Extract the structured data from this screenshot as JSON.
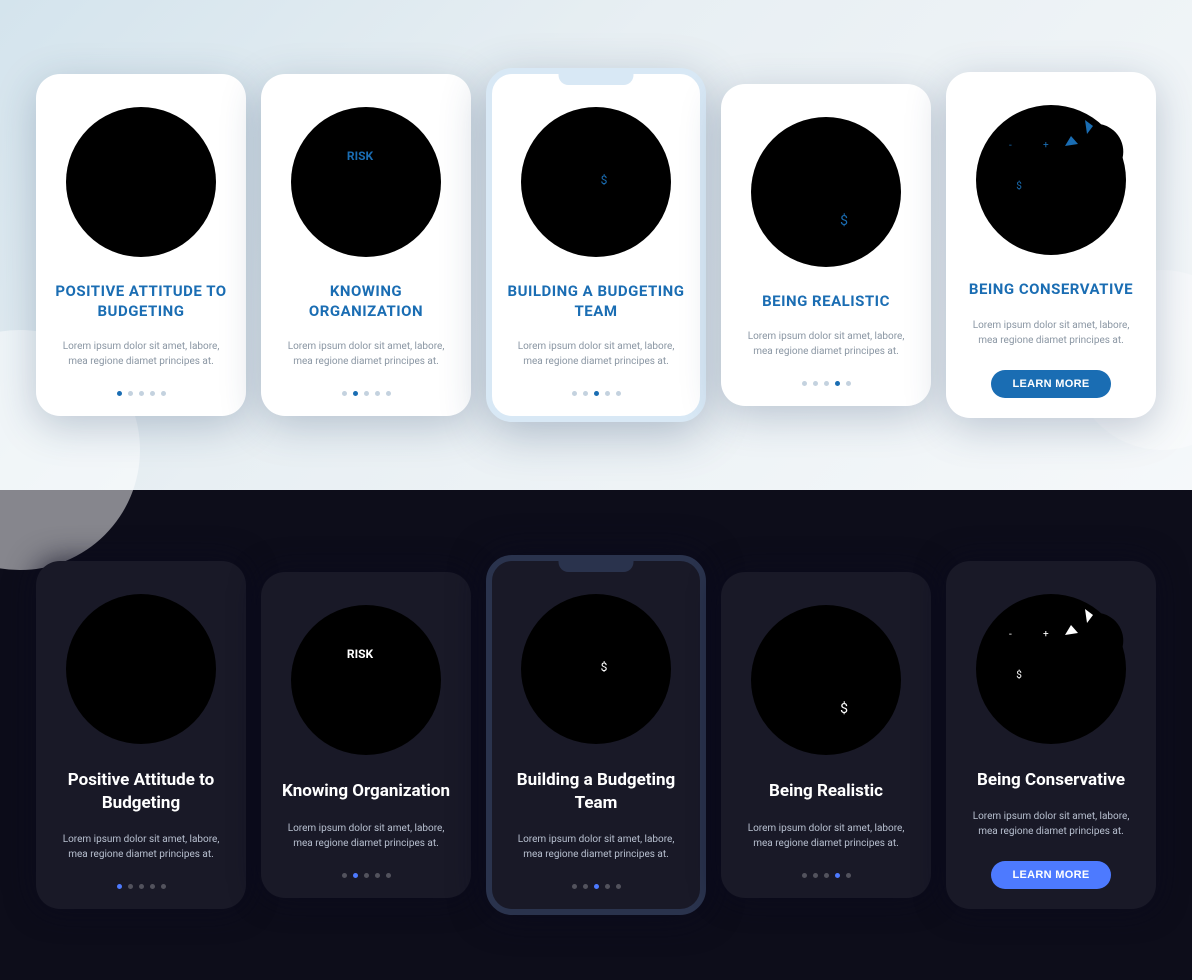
{
  "button_label": "LEARN MORE",
  "lorem": "Lorem ipsum dolor sit amet, labore, mea regione diamet principes at.",
  "light": {
    "cards": [
      {
        "title": "POSITIVE ATTITUDE TO BUDGETING",
        "icon": "budget-icon",
        "active": 0,
        "dots": 5
      },
      {
        "title": "KNOWING ORGANIZATION",
        "icon": "risk-icon",
        "active": 1,
        "dots": 5
      },
      {
        "title": "BUILDING A BUDGETING TEAM",
        "icon": "team-icon",
        "active": 2,
        "dots": 5,
        "special": true
      },
      {
        "title": "BEING REALISTIC",
        "icon": "realistic-icon",
        "active": 3,
        "dots": 5
      },
      {
        "title": "BEING CONSERVATIVE",
        "icon": "conservative-icon",
        "button": true
      }
    ]
  },
  "dark": {
    "cards": [
      {
        "title": "Positive Attitude to Budgeting",
        "icon": "budget-icon",
        "active": 0,
        "dots": 5
      },
      {
        "title": "Knowing Organization",
        "icon": "risk-icon",
        "active": 1,
        "dots": 5
      },
      {
        "title": "Building a Budgeting Team",
        "icon": "team-icon",
        "active": 2,
        "dots": 5,
        "special": true
      },
      {
        "title": "Being Realistic",
        "icon": "realistic-icon",
        "active": 3,
        "dots": 5
      },
      {
        "title": "Being Conservative",
        "icon": "conservative-icon",
        "button": true
      }
    ]
  }
}
